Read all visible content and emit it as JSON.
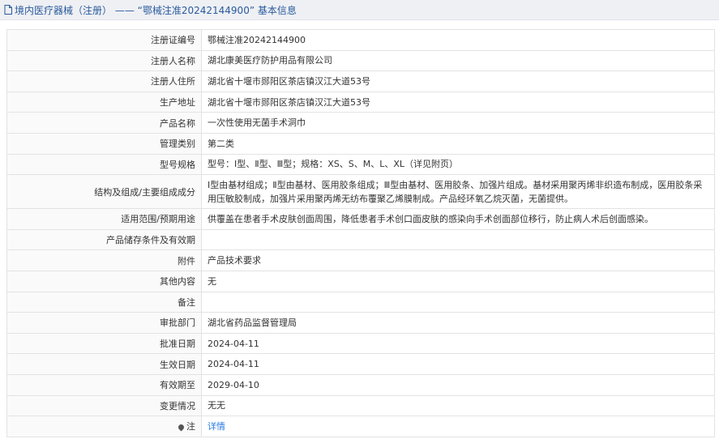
{
  "header": {
    "title": "境内医疗器械（注册） —— “鄂械注准20242144900” 基本信息",
    "icon": "document-icon"
  },
  "rows": [
    {
      "label": "注册证编号",
      "value": "鄂械注准20242144900"
    },
    {
      "label": "注册人名称",
      "value": "湖北康美医疗防护用品有限公司"
    },
    {
      "label": "注册人住所",
      "value": "湖北省十堰市郧阳区茶店镇汉江大道53号"
    },
    {
      "label": "生产地址",
      "value": "湖北省十堰市郧阳区茶店镇汉江大道53号"
    },
    {
      "label": "产品名称",
      "value": "一次性使用无菌手术洞巾"
    },
    {
      "label": "管理类别",
      "value": "第二类"
    },
    {
      "label": "型号规格",
      "value": "型号：Ⅰ型、Ⅱ型、Ⅲ型；规格：XS、S、M、L、XL（详见附页）"
    },
    {
      "label": "结构及组成/主要组成成分",
      "value": "Ⅰ型由基材组成；Ⅱ型由基材、医用胶条组成；Ⅲ型由基材、医用胶条、加强片组成。基材采用聚丙烯非织造布制成，医用胶条采用压敏胶制成，加强片采用聚丙烯无纺布覆聚乙烯膜制成。产品经环氧乙烷灭菌，无菌提供。"
    },
    {
      "label": "适用范围/预期用途",
      "value": "供覆盖在患者手术皮肤创面周围，降低患者手术创口面皮肤的感染向手术创面部位移行，防止病人术后创面感染。"
    },
    {
      "label": "产品储存条件及有效期",
      "value": ""
    },
    {
      "label": "附件",
      "value": "产品技术要求"
    },
    {
      "label": "其他内容",
      "value": "无"
    },
    {
      "label": "备注",
      "value": ""
    },
    {
      "label": "审批部门",
      "value": "湖北省药品监督管理局"
    },
    {
      "label": "批准日期",
      "value": "2024-04-11"
    },
    {
      "label": "生效日期",
      "value": "2024-04-11"
    },
    {
      "label": "有效期至",
      "value": "2029-04-10"
    },
    {
      "label": "变更情况",
      "value": "无无"
    }
  ],
  "note_row": {
    "label": "注",
    "link": "详情",
    "icon": "pin-icon"
  },
  "colors": {
    "link": "#2a7ae2",
    "header_text": "#2a5a9c",
    "header_bg": "#eef0f4"
  }
}
